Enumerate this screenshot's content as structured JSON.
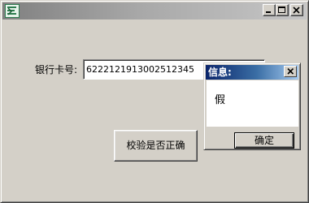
{
  "window": {
    "title": "",
    "icon": "app-logo-icon",
    "controls": [
      "minimize-icon",
      "maximize-icon",
      "close-icon"
    ]
  },
  "form": {
    "card_label": "银行卡号:",
    "card_value": "6222121913002512345",
    "verify_label": "校验是否正确"
  },
  "dialog": {
    "title": "信息:",
    "message": "假",
    "ok_label": "确定",
    "close_icon": "close-icon"
  },
  "colors": {
    "face": "#d4d0c8",
    "dialog_title_active": "#0a246a",
    "window_title_inactive": "#808080"
  }
}
